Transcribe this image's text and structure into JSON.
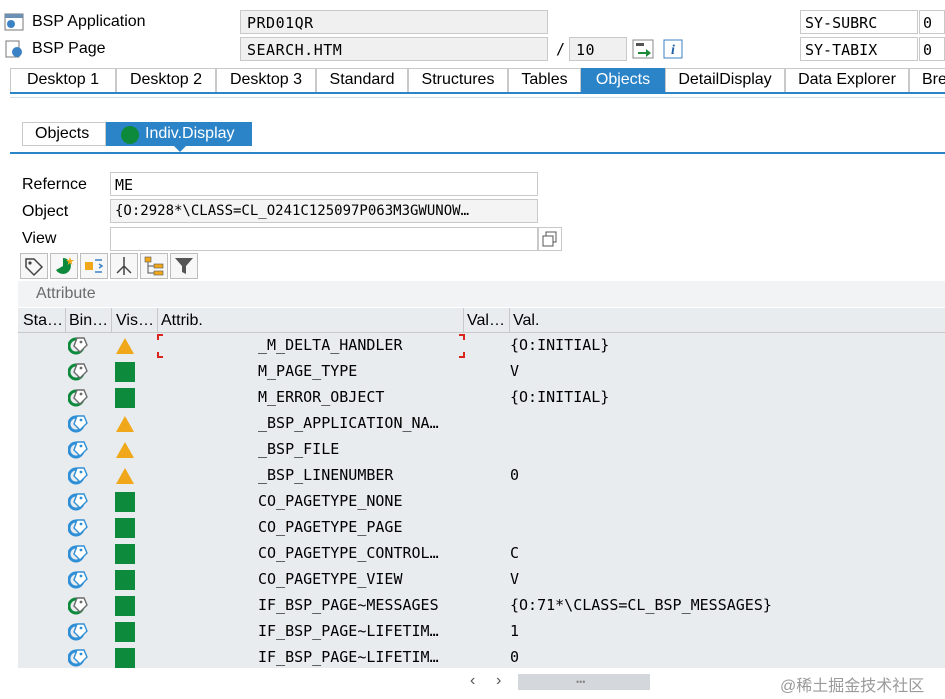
{
  "header": {
    "app_label": "BSP Application",
    "app_value": "PRD01QR",
    "page_label": "BSP Page",
    "page_value": "SEARCH.HTM",
    "slash": "/",
    "page_num": "10",
    "subrc_label": "SY-SUBRC",
    "subrc_value": "0",
    "tabix_label": "SY-TABIX",
    "tabix_value": "0"
  },
  "tabs": [
    "Desktop 1",
    "Desktop 2",
    "Desktop 3",
    "Standard",
    "Structures",
    "Tables",
    "Objects",
    "DetailDisplay",
    "Data Explorer",
    "Bre"
  ],
  "active_tab": "Objects",
  "subtabs": [
    "Objects",
    "Indiv.Display"
  ],
  "form": {
    "ref_label": "Refernce",
    "ref_value": "ME",
    "obj_label": "Object",
    "obj_value": "{O:2928*\\CLASS=CL_O241C125097P063M3GWUNOW…",
    "view_label": "View",
    "view_value": ""
  },
  "table": {
    "title": "Attribute",
    "columns": [
      "Sta…",
      "Bin…",
      "Vis…",
      "Attrib.",
      "Val…",
      "Val."
    ],
    "rows": [
      {
        "bind": "private",
        "vis": "warn",
        "attrib": "_M_DELTA_HANDLER",
        "val": "{O:INITIAL}"
      },
      {
        "bind": "private",
        "vis": "ok",
        "attrib": "M_PAGE_TYPE",
        "val": "V"
      },
      {
        "bind": "private",
        "vis": "ok",
        "attrib": "M_ERROR_OBJECT",
        "val": "{O:INITIAL}"
      },
      {
        "bind": "public",
        "vis": "warn",
        "attrib": "_BSP_APPLICATION_NA…",
        "val": ""
      },
      {
        "bind": "public",
        "vis": "warn",
        "attrib": "_BSP_FILE",
        "val": ""
      },
      {
        "bind": "public",
        "vis": "warn",
        "attrib": "_BSP_LINENUMBER",
        "val": "0"
      },
      {
        "bind": "public",
        "vis": "ok",
        "attrib": "CO_PAGETYPE_NONE",
        "val": ""
      },
      {
        "bind": "public",
        "vis": "ok",
        "attrib": "CO_PAGETYPE_PAGE",
        "val": ""
      },
      {
        "bind": "public",
        "vis": "ok",
        "attrib": "CO_PAGETYPE_CONTROL…",
        "val": "C"
      },
      {
        "bind": "public",
        "vis": "ok",
        "attrib": "CO_PAGETYPE_VIEW",
        "val": "V"
      },
      {
        "bind": "private",
        "vis": "ok",
        "attrib": "IF_BSP_PAGE~MESSAGES",
        "val": "{O:71*\\CLASS=CL_BSP_MESSAGES}"
      },
      {
        "bind": "public",
        "vis": "ok",
        "attrib": "IF_BSP_PAGE~LIFETIM…",
        "val": "1"
      },
      {
        "bind": "public",
        "vis": "ok",
        "attrib": "IF_BSP_PAGE~LIFETIM…",
        "val": "0"
      }
    ]
  },
  "colors": {
    "accent": "#2b83c8",
    "ok_green": "#0d8a3b",
    "warn_orange": "#f0a81a",
    "grid_bg": "#e8ecef"
  },
  "watermark": "@稀土掘金技术社区"
}
